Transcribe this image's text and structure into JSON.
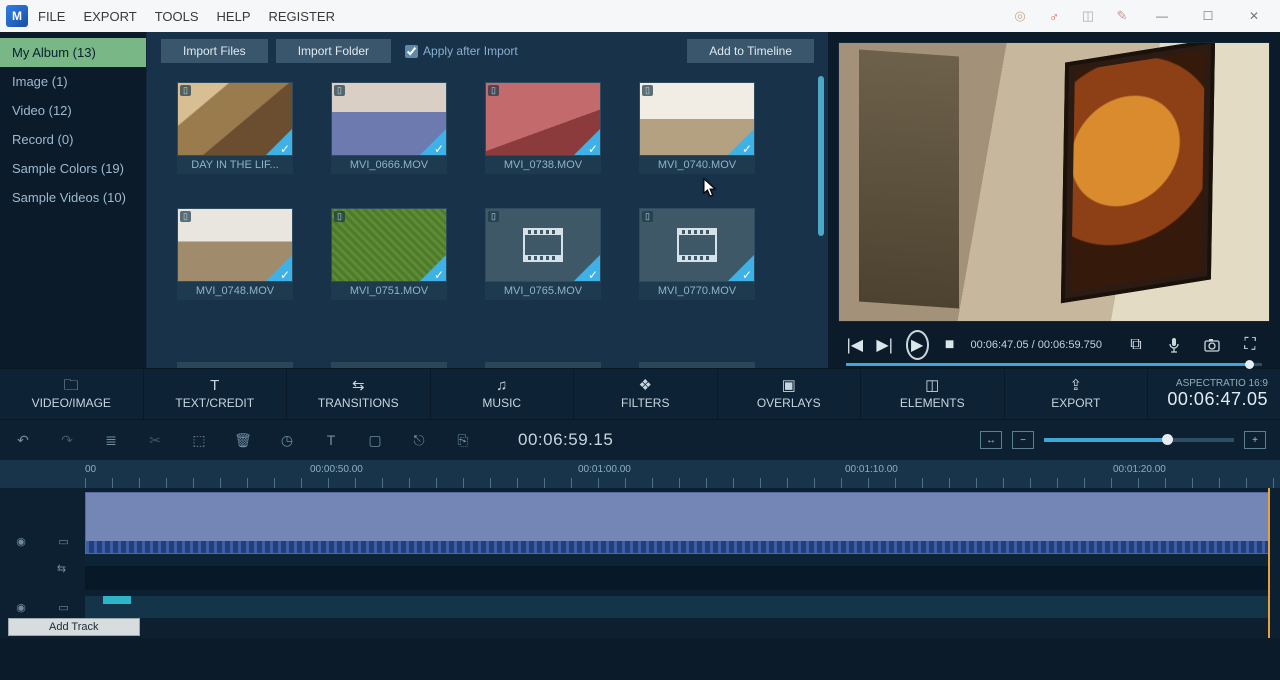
{
  "menu": {
    "file": "FILE",
    "export": "EXPORT",
    "tools": "TOOLS",
    "help": "HELP",
    "register": "REGISTER"
  },
  "sidebar": {
    "items": [
      {
        "label": "My Album (13)",
        "active": true
      },
      {
        "label": "Image (1)"
      },
      {
        "label": "Video (12)"
      },
      {
        "label": "Record (0)"
      },
      {
        "label": "Sample Colors (19)"
      },
      {
        "label": "Sample Videos (10)"
      }
    ]
  },
  "mediaToolbar": {
    "importFiles": "Import Files",
    "importFolder": "Import Folder",
    "applyAfter": "Apply after Import",
    "applyAfterChecked": true,
    "addTimeline": "Add to Timeline"
  },
  "media": [
    {
      "label": "DAY IN THE LIF...",
      "kind": "room1"
    },
    {
      "label": "MVI_0666.MOV",
      "kind": "person"
    },
    {
      "label": "MVI_0738.MOV",
      "kind": "red"
    },
    {
      "label": "MVI_0740.MOV",
      "kind": "living"
    },
    {
      "label": "MVI_0748.MOV",
      "kind": "patio"
    },
    {
      "label": "MVI_0751.MOV",
      "kind": "grass"
    },
    {
      "label": "MVI_0765.MOV",
      "kind": "film"
    },
    {
      "label": "MVI_0770.MOV",
      "kind": "film"
    }
  ],
  "preview": {
    "curTime": "00:06:47.05",
    "totTime": "00:06:59.750",
    "progressPct": 96.9
  },
  "modules": {
    "videoimage": "VIDEO/IMAGE",
    "textcredit": "TEXT/CREDIT",
    "transitions": "TRANSITIONS",
    "music": "MUSIC",
    "filters": "FILTERS",
    "overlays": "OVERLAYS",
    "elements": "ELEMENTS",
    "export": "EXPORT"
  },
  "aspect": {
    "label": "ASPECTRATIO 16:9",
    "time": "00:06:47.05"
  },
  "toolstrip": {
    "time": "00:06:59.15",
    "zoomPct": 65
  },
  "ruler": {
    "marks": [
      "00",
      "00:00:50.00",
      "00:01:00.00",
      "00:01:10.00",
      "00:01:20.00"
    ],
    "marksPx": [
      0,
      225,
      493,
      760,
      1028
    ]
  },
  "addTrack": "Add Track"
}
